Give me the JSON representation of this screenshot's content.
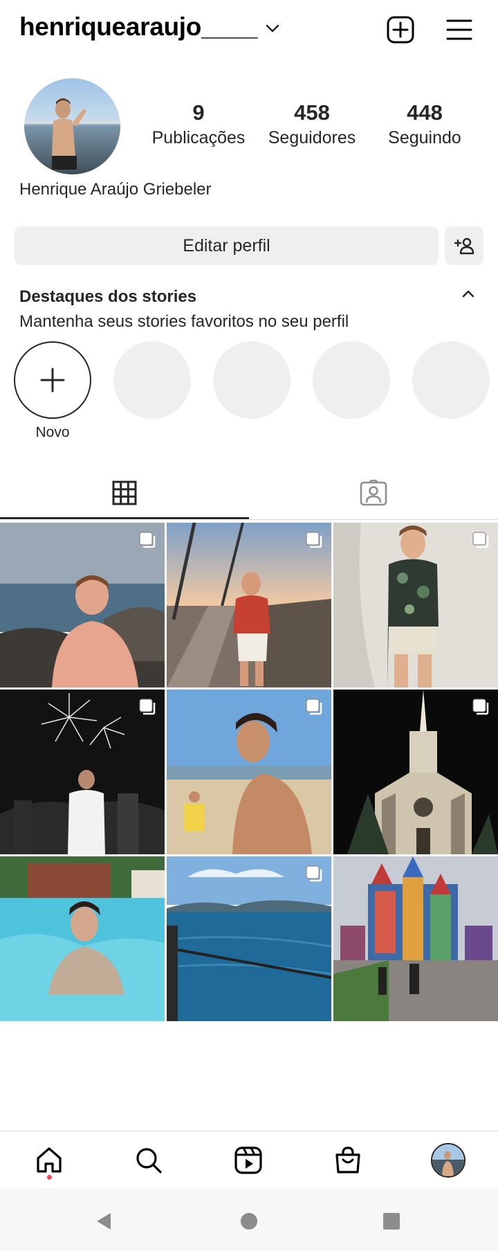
{
  "header": {
    "username": "henriquearaujo____",
    "icons": {
      "account_switch": "chevron-down-icon",
      "new_post": "plus-square-icon",
      "menu": "hamburger-menu-icon"
    }
  },
  "profile": {
    "full_name": "Henrique Araújo Griebeler",
    "stats": {
      "posts": {
        "value": "9",
        "label": "Publicações"
      },
      "followers": {
        "value": "458",
        "label": "Seguidores"
      },
      "following": {
        "value": "448",
        "label": "Seguindo"
      }
    },
    "edit_button": "Editar perfil",
    "discover_people_icon": "add-user-icon"
  },
  "highlights": {
    "title": "Destaques dos stories",
    "subtitle": "Mantenha seus stories favoritos no seu perfil",
    "new_label": "Novo",
    "placeholder_count": 4
  },
  "tabs": [
    {
      "name": "grid",
      "icon": "grid-icon",
      "active": true
    },
    {
      "name": "tagged",
      "icon": "tagged-person-icon",
      "active": false
    }
  ],
  "posts": [
    {
      "scene": "beach rocks shirtless",
      "multi": true
    },
    {
      "scene": "boardwalk sunset red shirt",
      "multi": true
    },
    {
      "scene": "floral shirt white wall",
      "multi": true
    },
    {
      "scene": "fireworks night white shirt",
      "multi": true
    },
    {
      "scene": "beach profile shirtless",
      "multi": true
    },
    {
      "scene": "church lit at night",
      "multi": true
    },
    {
      "scene": "pool",
      "multi": false
    },
    {
      "scene": "sea view",
      "multi": true
    },
    {
      "scene": "colorful castle park",
      "multi": false
    }
  ],
  "bottom_nav": [
    {
      "name": "home",
      "icon": "home-icon",
      "notification_dot": true
    },
    {
      "name": "search",
      "icon": "search-icon"
    },
    {
      "name": "reels",
      "icon": "reels-icon"
    },
    {
      "name": "shop",
      "icon": "shopping-bag-icon"
    },
    {
      "name": "profile",
      "icon": "profile-avatar"
    }
  ],
  "system_nav": [
    "back-icon",
    "home-circle-icon",
    "recents-square-icon"
  ],
  "colors": {
    "text": "#262626",
    "button_bg": "#efefef",
    "divider": "#dbdbdb",
    "notification": "#ed4956"
  }
}
